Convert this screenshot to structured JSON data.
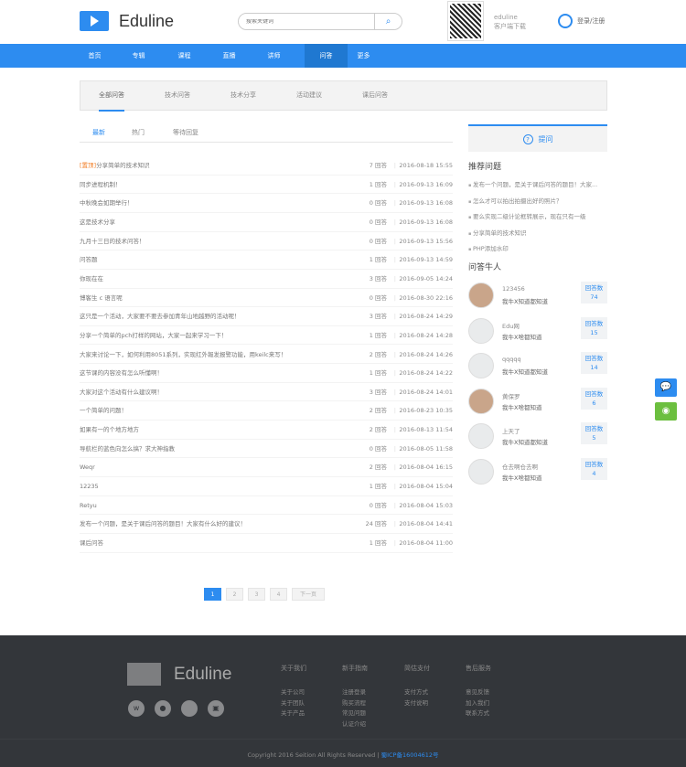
{
  "header": {
    "logo_text": "Eduline",
    "search_placeholder": "搜索关键词",
    "app_name": "eduline",
    "app_download": "客户端下载",
    "login": "登录",
    "register": "注册"
  },
  "nav": [
    {
      "label": "首页"
    },
    {
      "label": "专辑"
    },
    {
      "label": "课程"
    },
    {
      "label": "直播"
    },
    {
      "label": "讲师"
    },
    {
      "label": "问答",
      "active": true
    },
    {
      "label": "更多"
    }
  ],
  "categories": [
    "全部问答",
    "技术问答",
    "技术分享",
    "活动建议",
    "课后问答"
  ],
  "sort_tabs": [
    "最新",
    "热门",
    "等待回复"
  ],
  "answer_suffix": "回答",
  "questions": [
    {
      "tag": "[置顶]",
      "title": "分享简单的技术知识",
      "answers": 7,
      "date": "2016-08-18 15:55"
    },
    {
      "title": "同步进程机制！",
      "answers": 1,
      "date": "2016-09-13 16:09"
    },
    {
      "title": "中秋晚会如期举行！",
      "answers": 0,
      "date": "2016-09-13 16:08"
    },
    {
      "title": "这是技术分享",
      "answers": 0,
      "date": "2016-09-13 16:08"
    },
    {
      "title": "九月十三日的技术问答！",
      "answers": 0,
      "date": "2016-09-13 15:56"
    },
    {
      "title": "问答题",
      "answers": 1,
      "date": "2016-09-13 14:59"
    },
    {
      "title": "你现在在",
      "answers": 3,
      "date": "2016-09-05 14:24"
    },
    {
      "title": "博客生 c 语言呢",
      "answers": 0,
      "date": "2016-08-30 22:16"
    },
    {
      "title": "这只是一个活动，大家要不要去参加青年山地越野的活动呢！",
      "answers": 3,
      "date": "2016-08-24 14:29"
    },
    {
      "title": "分享一个简单的pch打样的网站，大家一起来学习一下！",
      "answers": 1,
      "date": "2016-08-24 14:28"
    },
    {
      "title": "大家来讨论一下，如何利用8051系列，实现红外報发报警功能，用keilc来写！",
      "answers": 2,
      "date": "2016-08-24 14:26"
    },
    {
      "title": "这节课的内容没有怎么听懂啊！",
      "answers": 1,
      "date": "2016-08-24 14:22"
    },
    {
      "title": "大家对这个活动有什么建议啊！",
      "answers": 3,
      "date": "2016-08-24 14:01"
    },
    {
      "title": "一个简单的问题！",
      "answers": 2,
      "date": "2016-08-23 10:35"
    },
    {
      "title": "如果有一的个地方地方",
      "answers": 2,
      "date": "2016-08-13 11:54"
    },
    {
      "title": "导航栏的蓝色向怎么搞？求大神指教",
      "answers": 0,
      "date": "2016-08-05 11:58"
    },
    {
      "title": "Weqr",
      "answers": 2,
      "date": "2016-08-04 16:15"
    },
    {
      "title": "12235",
      "answers": 1,
      "date": "2016-08-04 15:04"
    },
    {
      "title": "Retyu",
      "answers": 0,
      "date": "2016-08-04 15:03"
    },
    {
      "title": "发布一个问题，是关于课后问答的题目！大家有什么好的建议！",
      "answers": 24,
      "date": "2016-08-04 14:41"
    },
    {
      "title": "课后问答",
      "answers": 1,
      "date": "2016-08-04 11:00"
    }
  ],
  "sidebar": {
    "ask_label": "提问",
    "recommend_title": "推荐问题",
    "recommend": [
      "发布一个问题，是关于课后问答的题目！大家...",
      "怎么才可以拍出拍摄出好的照片？",
      "要么实现二级计论框转展示，现在只有一级",
      "分享简单的技术知识",
      "PHP添加水印"
    ],
    "experts_title": "问答牛人",
    "count_label": "回答数",
    "experts": [
      {
        "name": "123456",
        "desc": "我牛X知道都知道",
        "count": 74,
        "photo": true
      },
      {
        "name": "Edu网",
        "desc": "我牛X啥都知道",
        "count": 15
      },
      {
        "name": "qqqqq",
        "desc": "我牛X知道都知道",
        "count": 14
      },
      {
        "name": "黄保罗",
        "desc": "我牛X啥都知道",
        "count": 6,
        "photo": true
      },
      {
        "name": "上天了",
        "desc": "我牛X知道都知道",
        "count": 5
      },
      {
        "name": "仓去啊仓去啊",
        "desc": "我牛X啥都知道",
        "count": 4
      }
    ]
  },
  "pagination": [
    "1",
    "2",
    "3",
    "4",
    "下一页"
  ],
  "footer": {
    "logo_text": "Eduline",
    "columns": [
      {
        "title": "关于我们",
        "links": [
          "关于公司",
          "关于团队",
          "关于产品"
        ]
      },
      {
        "title": "新手指南",
        "links": [
          "注册登录",
          "购买流程",
          "常见问题",
          "认证介绍"
        ]
      },
      {
        "title": "简估支付",
        "links": [
          "支付方式",
          "支付说明"
        ]
      },
      {
        "title": "售后服务",
        "links": [
          "意见反馈",
          "加入我们",
          "联系方式"
        ]
      }
    ],
    "copyright": "Copyright 2016 Seition All Rights Reserved | ",
    "icp": "蜀ICP备16004612号"
  },
  "colors": {
    "primary": "#2d8cf0",
    "footer_bg": "#33363a",
    "tag": "#f27c22",
    "chat": "#2d8cf0",
    "wechat": "#6cbf3f"
  }
}
